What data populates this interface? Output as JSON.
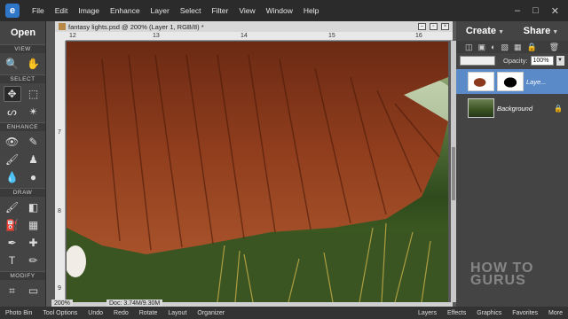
{
  "menubar": {
    "items": [
      "File",
      "Edit",
      "Image",
      "Enhance",
      "Layer",
      "Select",
      "Filter",
      "View",
      "Window",
      "Help"
    ]
  },
  "tools": {
    "open_label": "Open",
    "sections": {
      "view": "VIEW",
      "select": "SELECT",
      "enhance": "ENHANCE",
      "draw": "DRAW",
      "modify": "MODIFY"
    }
  },
  "document": {
    "tab_title": "fantasy lights.psd @ 200% (Layer 1, RGB/8) *",
    "ruler_top": [
      "12",
      "13",
      "14",
      "15",
      "16"
    ],
    "ruler_left": [
      "7",
      "8",
      "9"
    ],
    "zoom": "200%",
    "doc_size": "Doc: 3.74M/9.30M"
  },
  "right_panel": {
    "create_label": "Create",
    "share_label": "Share",
    "opacity_label": "Opacity:",
    "opacity_value": "100%",
    "layers": [
      {
        "name": "Laye...",
        "selected": true
      },
      {
        "name": "Background",
        "selected": false
      }
    ]
  },
  "bottombar": {
    "items": [
      "Photo Bin",
      "Tool Options",
      "Undo",
      "Redo",
      "Rotate",
      "Layout",
      "Organizer"
    ],
    "right_items": [
      "Layers",
      "Effects",
      "Graphics",
      "Favorites",
      "More"
    ]
  },
  "brand": "HOW TO GURUS",
  "colors": {
    "selected_layer": "#5b8ac8",
    "app_icon": "#2f76c8"
  }
}
